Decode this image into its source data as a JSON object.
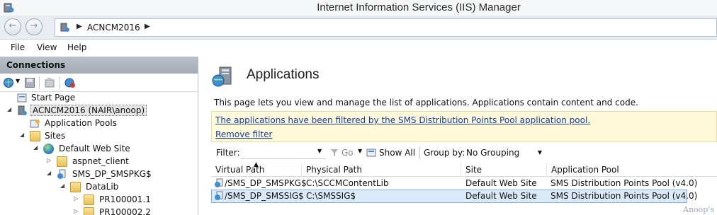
{
  "window": {
    "title": "Internet Information Services (IIS) Manager"
  },
  "address": {
    "crumbs": [
      "ACNCM2016"
    ]
  },
  "menu": {
    "items": [
      "File",
      "View",
      "Help"
    ]
  },
  "connections": {
    "header": "Connections",
    "tree": [
      {
        "label": "Start Page",
        "icon": "start-page-icon"
      },
      {
        "label": "ACNCM2016 (NAIR\\anoop)",
        "icon": "server-icon",
        "expanded": true,
        "selected": true
      },
      {
        "label": "Application Pools",
        "icon": "app-pools-icon"
      },
      {
        "label": "Sites",
        "icon": "sites-icon",
        "expanded": true
      },
      {
        "label": "Default Web Site",
        "icon": "globe-icon",
        "expanded": true
      },
      {
        "label": "aspnet_client",
        "icon": "folder-icon",
        "collapsed": true
      },
      {
        "label": "SMS_DP_SMSPKG$",
        "icon": "application-icon",
        "expanded": true
      },
      {
        "label": "DataLib",
        "icon": "folder-icon",
        "expanded": true
      },
      {
        "label": "PR100001.1",
        "icon": "folder-icon",
        "collapsed": true
      },
      {
        "label": "PR100002.2",
        "icon": "folder-icon",
        "collapsed": true
      }
    ]
  },
  "main": {
    "title": "Applications",
    "description": "This page lets you view and manage the list of applications. Applications contain content and code.",
    "filter_notice": "The applications have been filtered by the SMS Distribution Points Pool application pool.",
    "remove_filter": "Remove filter",
    "filter_label": "Filter:",
    "filter_value": "",
    "go_label": "Go",
    "show_all_label": "Show All",
    "group_by_label": "Group by:",
    "group_by_value": "No Grouping",
    "columns": [
      "Virtual Path",
      "Physical Path",
      "Site",
      "Application Pool"
    ],
    "rows": [
      {
        "virtual_path": "/SMS_DP_SMSPKG$",
        "physical_path": "C:\\SCCMContentLib",
        "site": "Default Web Site",
        "app_pool": "SMS Distribution Points Pool (v4.0)",
        "selected": false
      },
      {
        "virtual_path": "/SMS_DP_SMSSIG$",
        "physical_path": "C:\\SMSSIG$",
        "site": "Default Web Site",
        "app_pool": "SMS Distribution Points Pool (v4.0)",
        "selected": true
      }
    ]
  },
  "watermark": "Anoop's",
  "colors": {
    "accent": "#1a3c99",
    "banner": "#fdf9d8",
    "selection": "#dbeaf9",
    "pane_header": "#a3abb5"
  }
}
